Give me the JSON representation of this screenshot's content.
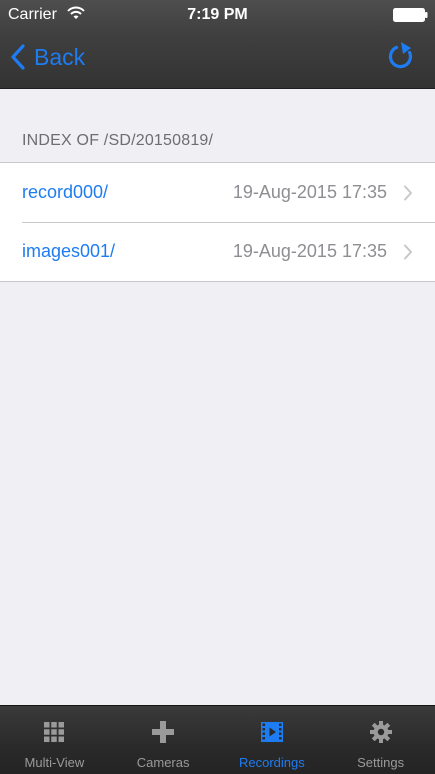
{
  "status_bar": {
    "carrier": "Carrier",
    "time": "7:19 PM",
    "wifi_icon": "wifi-icon",
    "battery_icon": "battery-icon"
  },
  "nav": {
    "back_label": "Back",
    "back_icon": "chevron-left-icon",
    "refresh_icon": "refresh-icon"
  },
  "section": {
    "header": "INDEX OF /SD/20150819/"
  },
  "rows": [
    {
      "name": "record000/",
      "date": "19-Aug-2015 17:35"
    },
    {
      "name": "images001/",
      "date": "19-Aug-2015 17:35"
    }
  ],
  "tabs": [
    {
      "label": "Multi-View",
      "icon": "grid-icon",
      "active": false
    },
    {
      "label": "Cameras",
      "icon": "plus-icon",
      "active": false
    },
    {
      "label": "Recordings",
      "icon": "film-icon",
      "active": true
    },
    {
      "label": "Settings",
      "icon": "gear-icon",
      "active": false
    }
  ],
  "colors": {
    "accent": "#1e7cf2",
    "header_background": "#3f3f3f",
    "content_background": "#efeff4",
    "tabbar_background": "#2a2a2a",
    "inactive_tab": "#9a9a9a"
  }
}
